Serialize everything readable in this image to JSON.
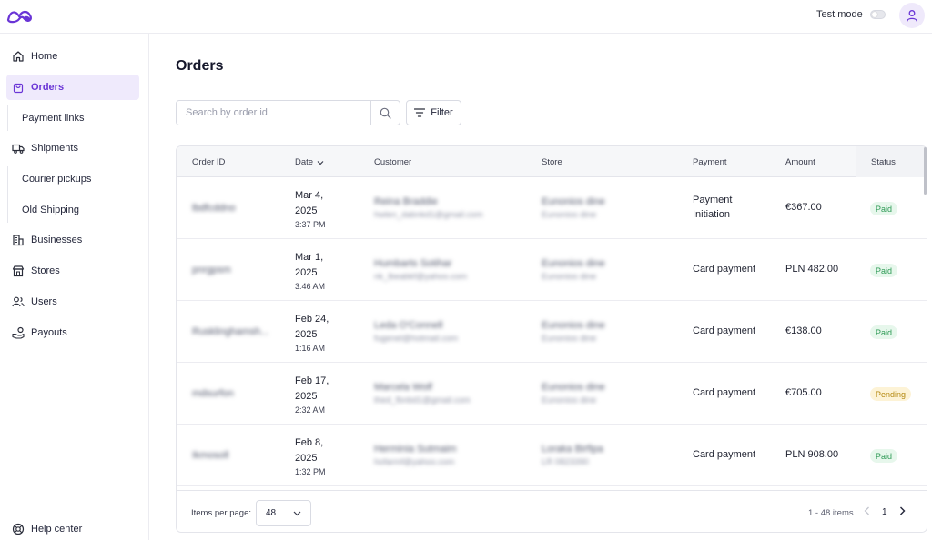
{
  "topbar": {
    "test_mode_label": "Test mode",
    "test_mode_on": false
  },
  "sidebar": {
    "items": [
      {
        "label": "Home",
        "icon": "home-icon"
      },
      {
        "label": "Orders",
        "icon": "bag-icon",
        "active": true
      },
      {
        "label": "Payment links",
        "sub": true
      },
      {
        "label": "Shipments",
        "icon": "truck-icon"
      },
      {
        "label": "Courier pickups",
        "sub": true
      },
      {
        "label": "Old Shipping",
        "sub": true
      },
      {
        "label": "Businesses",
        "icon": "building-icon"
      },
      {
        "label": "Stores",
        "icon": "store-icon"
      },
      {
        "label": "Users",
        "icon": "users-icon"
      },
      {
        "label": "Payouts",
        "icon": "payouts-icon"
      }
    ],
    "help_label": "Help center"
  },
  "main": {
    "title": "Orders",
    "search_placeholder": "Search by order id",
    "filter_label": "Filter"
  },
  "table": {
    "headers": {
      "order_id": "Order ID",
      "date": "Date",
      "customer": "Customer",
      "store": "Store",
      "payment": "Payment",
      "amount": "Amount",
      "status": "Status"
    },
    "rows": [
      {
        "order_id": "lbdfcddno",
        "date_line1": "Mar 4,",
        "date_line2": "2025",
        "time": "3:37 PM",
        "customer_name": "Reina Braddie",
        "customer_email": "hwlen_dabnkd1@gmail.com",
        "store_name": "Eunonios dine",
        "store_sub": "Eunonios dine",
        "payment": "Payment Initiation",
        "amount": "€367.00",
        "status": "Paid"
      },
      {
        "order_id": "pnrgpsm",
        "date_line1": "Mar 1,",
        "date_line2": "2025",
        "time": "3:46 AM",
        "customer_name": "Humbarts Sotihar",
        "customer_email": "nk_lbeabkf@yahoo.com",
        "store_name": "Eunonios dine",
        "store_sub": "Eunonios dine",
        "payment": "Card payment",
        "amount": "PLN 482.00",
        "status": "Paid"
      },
      {
        "order_id": "Rusklinghamsh...",
        "date_line1": "Feb 24,",
        "date_line2": "2025",
        "time": "1:16 AM",
        "customer_name": "Leda O'Connell",
        "customer_email": "fugenel@hotmail.com",
        "store_name": "Eunonios dine",
        "store_sub": "Eunonios dine",
        "payment": "Card payment",
        "amount": "€138.00",
        "status": "Paid"
      },
      {
        "order_id": "mdsurfon",
        "date_line1": "Feb 17,",
        "date_line2": "2025",
        "time": "2:32 AM",
        "customer_name": "Marcela Wolf",
        "customer_email": "thed_fbnbd1@gmail.com",
        "store_name": "Eunonios dine",
        "store_sub": "Eunonios dine",
        "payment": "Card payment",
        "amount": "€705.00",
        "status": "Pending"
      },
      {
        "order_id": "Ikmosoll",
        "date_line1": "Feb 8,",
        "date_line2": "2025",
        "time": "1:32 PM",
        "customer_name": "Herminia Sutmaim",
        "customer_email": "hofarmf@yahoo.com",
        "store_name": "Loraka Birfipa",
        "store_sub": "LR 0823390",
        "payment": "Card payment",
        "amount": "PLN 908.00",
        "status": "Paid"
      }
    ]
  },
  "footer": {
    "items_per_page_label": "Items per page:",
    "items_per_page_value": "48",
    "range_label": "1 - 48 items",
    "current_page": "1"
  },
  "colors": {
    "accent": "#6a35d6",
    "accent_bg": "#efeafc",
    "paid_bg": "#e7f7ec",
    "paid_fg": "#2e9a55",
    "pending_bg": "#fdf3d6",
    "pending_fg": "#b58a12"
  }
}
